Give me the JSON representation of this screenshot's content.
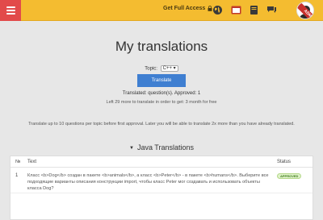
{
  "header": {
    "full_access_label": "Get Full Access",
    "ribbon_text": "ADM"
  },
  "page": {
    "title": "My translations",
    "topic_label": "Topic:",
    "topic_value": "C++",
    "translate_button": "Translate",
    "stats": "Translated: question(s). Approved: 1",
    "left_info": "Left 29 more to translate in order to get: 3 month for free",
    "note": "Translate up to 10 questions per topic before first approval. Later you will be able to translate 2x more than you have already translated."
  },
  "section": {
    "title": "Java Translations"
  },
  "table": {
    "headers": {
      "num": "№",
      "text": "Text",
      "status": "Status"
    },
    "rows": [
      {
        "num": "1",
        "text": "Класс <b>Dog</b> создан в пакете <b>animals</b>, а класс <b>Peter</b> - в пакете <b>humans</b>. Выберите все подходящие варианты описания конструкции import, чтобы класс Peter мог создавать и использовать объекты класса Dog?",
        "status": "APPROVED"
      }
    ]
  },
  "colors": {
    "header_bg": "#f4bc30",
    "menu_bg": "#e24a4a",
    "primary_button": "#3f7fd1",
    "approved_badge": "#dff2c8"
  },
  "icons": [
    "menu-icon",
    "lock-icon",
    "globe-icon",
    "browser-icon",
    "book-icon",
    "chat-icon"
  ]
}
